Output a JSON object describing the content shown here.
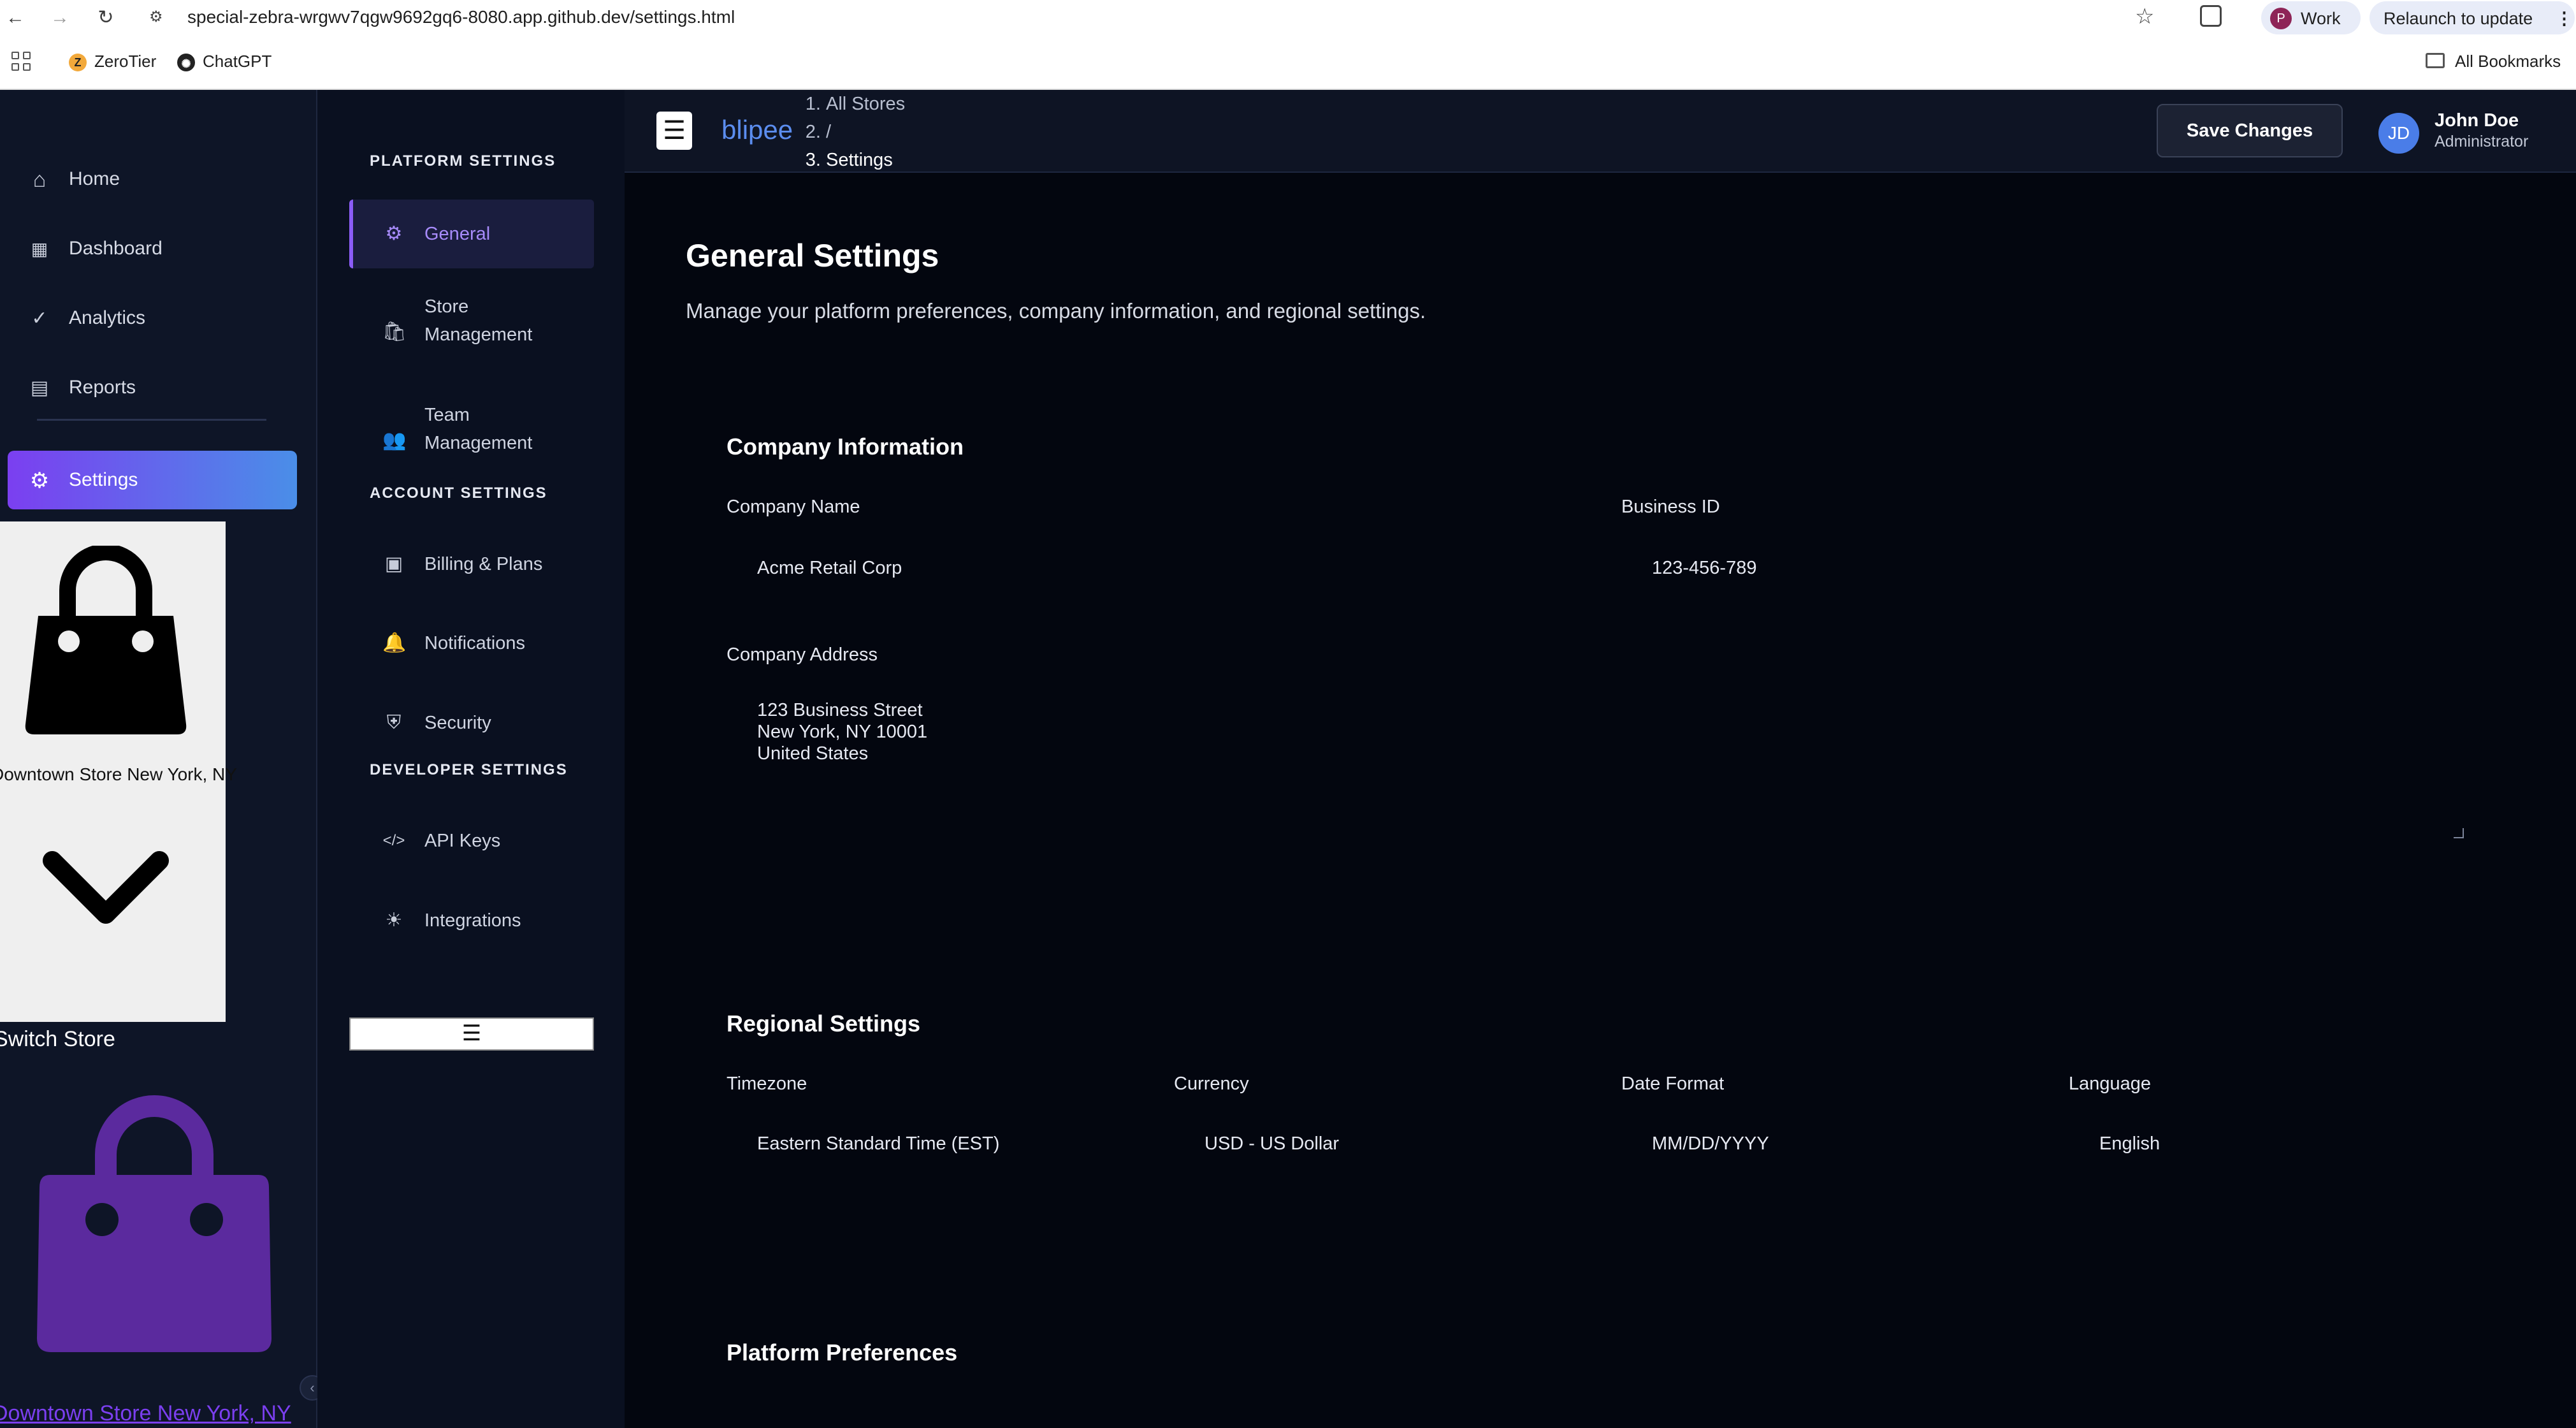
{
  "browser": {
    "url": "special-zebra-wrgwv7qgw9692gq6-8080.app.github.dev/settings.html",
    "profile_initial": "P",
    "profile_label": "Work",
    "relaunch_label": "Relaunch to update",
    "bookmarks": [
      {
        "label": "ZeroTier"
      },
      {
        "label": "ChatGPT"
      }
    ],
    "all_bookmarks_label": "All Bookmarks"
  },
  "sidebar": {
    "items": [
      {
        "label": "Home",
        "icon": "home-icon"
      },
      {
        "label": "Dashboard",
        "icon": "dashboard-icon"
      },
      {
        "label": "Analytics",
        "icon": "analytics-icon"
      },
      {
        "label": "Reports",
        "icon": "reports-icon"
      },
      {
        "label": "Settings",
        "icon": "gear-icon"
      }
    ],
    "store_dropdown_name": "Downtown Store New York, NY",
    "switch_store_label": "Switch Store",
    "store_link_label": "Downtown Store New York, NY"
  },
  "settings_nav": {
    "platform_heading": "PLATFORM SETTINGS",
    "account_heading": "ACCOUNT SETTINGS",
    "developer_heading": "DEVELOPER SETTINGS",
    "items": {
      "general": "General",
      "store_management_1": "Store",
      "store_management_2": "Management",
      "team_management_1": "Team",
      "team_management_2": "Management",
      "billing": "Billing & Plans",
      "notifications": "Notifications",
      "security": "Security",
      "api_keys": "API Keys",
      "integrations": "Integrations"
    }
  },
  "header": {
    "brand": "blipee",
    "breadcrumb": [
      "All Stores",
      "/",
      "Settings"
    ],
    "save_label": "Save Changes",
    "user_initials": "JD",
    "user_name": "John Doe",
    "user_role": "Administrator"
  },
  "main": {
    "title": "General Settings",
    "description": "Manage your platform preferences, company information, and regional settings.",
    "company": {
      "title": "Company Information",
      "name_label": "Company Name",
      "name_value": "Acme Retail Corp",
      "business_id_label": "Business ID",
      "business_id_value": "123-456-789",
      "address_label": "Company Address",
      "address_lines": [
        "123 Business Street",
        "New York, NY 10001",
        "United States"
      ]
    },
    "regional": {
      "title": "Regional Settings",
      "timezone_label": "Timezone",
      "timezone_value": "Eastern Standard Time (EST)",
      "currency_label": "Currency",
      "currency_value": "USD - US Dollar",
      "date_format_label": "Date Format",
      "date_format_value": "MM/DD/YYYY",
      "language_label": "Language",
      "language_value": "English"
    },
    "preferences": {
      "title": "Platform Preferences"
    }
  },
  "colors": {
    "accent": "#7b3ff0",
    "accent_blue": "#4a8ee8",
    "active_sub": "#a78bfa",
    "background": "#03060f"
  }
}
